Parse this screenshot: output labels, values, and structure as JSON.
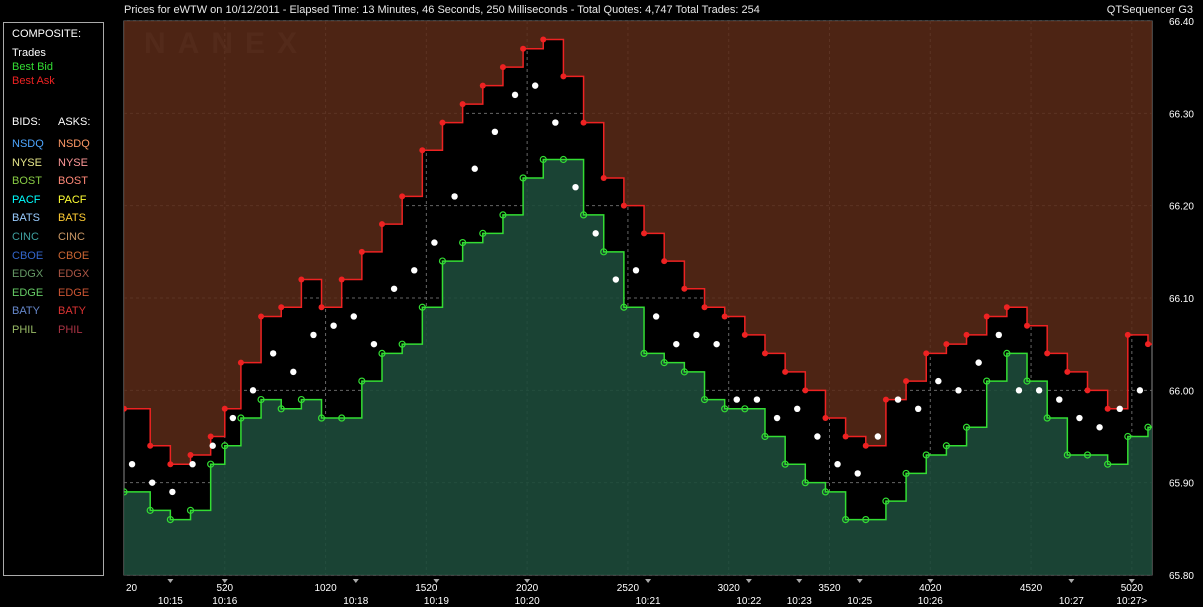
{
  "window": {
    "title": "Prices for  eWTW  on  10/12/2011  -  Elapsed Time: 13 Minutes, 46 Seconds, 250 Milliseconds  -  Total Quotes: 4,747  Total Trades: 254",
    "app_name": "QTSequencer G3"
  },
  "legend": {
    "composite_label": "COMPOSITE:",
    "composite": [
      {
        "label": "Trades",
        "color": "#ffffff"
      },
      {
        "label": "Best Bid",
        "color": "#33dd33"
      },
      {
        "label": "Best Ask",
        "color": "#ee2222"
      }
    ],
    "bids_label": "BIDS:",
    "asks_label": "ASKS:",
    "exchanges": [
      {
        "bid": "NSDQ",
        "ask": "NSDQ",
        "bid_color": "#4da6ff",
        "ask_color": "#ff9966"
      },
      {
        "bid": "NYSE",
        "ask": "NYSE",
        "bid_color": "#e6e68a",
        "ask_color": "#ff9999"
      },
      {
        "bid": "BOST",
        "ask": "BOST",
        "bid_color": "#88cc44",
        "ask_color": "#ff8877"
      },
      {
        "bid": "PACF",
        "ask": "PACF",
        "bid_color": "#00ffff",
        "ask_color": "#ffff33"
      },
      {
        "bid": "BATS",
        "ask": "BATS",
        "bid_color": "#99ccff",
        "ask_color": "#ffcc33"
      },
      {
        "bid": "CINC",
        "ask": "CINC",
        "bid_color": "#3fa0a0",
        "ask_color": "#cc9966"
      },
      {
        "bid": "CBOE",
        "ask": "CBOE",
        "bid_color": "#3366cc",
        "ask_color": "#cc6633"
      },
      {
        "bid": "EDGX",
        "ask": "EDGX",
        "bid_color": "#669966",
        "ask_color": "#aa5544"
      },
      {
        "bid": "EDGE",
        "ask": "EDGE",
        "bid_color": "#66cc66",
        "ask_color": "#cc5533"
      },
      {
        "bid": "BATY",
        "ask": "BATY",
        "bid_color": "#6688cc",
        "ask_color": "#dd3333"
      },
      {
        "bid": "PHIL",
        "ask": "PHIL",
        "bid_color": "#99bb66",
        "ask_color": "#aa3344"
      }
    ]
  },
  "watermark": "NANEX",
  "chart_data": {
    "type": "line",
    "ylim": [
      65.8,
      66.4
    ],
    "y_ticks": [
      "65.80",
      "65.90",
      "66.00",
      "66.10",
      "66.20",
      "66.30",
      "66.40"
    ],
    "x_seq_ticks": [
      "20",
      "520",
      "1020",
      "1520",
      "2020",
      "2520",
      "3020",
      "3520",
      "4020",
      "4520",
      "5020"
    ],
    "x_time_ticks": [
      "10:15",
      "10:16",
      "10:18",
      "10:19",
      "10:20",
      "10:21",
      "10:22",
      "10:23",
      "10:25",
      "10:26",
      "10:27",
      "10:27>"
    ],
    "x_time_seq": [
      250,
      520,
      1170,
      1570,
      2020,
      2620,
      3120,
      3370,
      3670,
      4020,
      4720,
      5020
    ],
    "xlim": [
      20,
      5120
    ],
    "series": [
      {
        "name": "Best Bid",
        "color": "#33dd33",
        "x": [
          20,
          150,
          250,
          350,
          450,
          520,
          600,
          700,
          800,
          900,
          1000,
          1100,
          1200,
          1300,
          1400,
          1500,
          1600,
          1700,
          1800,
          1900,
          2000,
          2100,
          2200,
          2300,
          2400,
          2500,
          2600,
          2700,
          2800,
          2900,
          3000,
          3100,
          3200,
          3300,
          3400,
          3500,
          3600,
          3700,
          3800,
          3900,
          4000,
          4100,
          4200,
          4300,
          4400,
          4500,
          4600,
          4700,
          4800,
          4900,
          5000,
          5100
        ],
        "y": [
          65.89,
          65.87,
          65.86,
          65.87,
          65.92,
          65.94,
          65.97,
          65.99,
          65.98,
          65.99,
          65.97,
          65.97,
          66.01,
          66.04,
          66.05,
          66.09,
          66.14,
          66.16,
          66.17,
          66.19,
          66.23,
          66.25,
          66.25,
          66.19,
          66.15,
          66.09,
          66.04,
          66.03,
          66.02,
          65.99,
          65.98,
          65.98,
          65.95,
          65.92,
          65.9,
          65.89,
          65.86,
          65.86,
          65.88,
          65.91,
          65.93,
          65.94,
          65.96,
          66.01,
          66.04,
          66.01,
          65.97,
          65.93,
          65.93,
          65.92,
          65.95,
          65.96
        ]
      },
      {
        "name": "Best Ask",
        "color": "#ee2222",
        "x": [
          20,
          150,
          250,
          350,
          450,
          520,
          600,
          700,
          800,
          900,
          1000,
          1100,
          1200,
          1300,
          1400,
          1500,
          1600,
          1700,
          1800,
          1900,
          2000,
          2100,
          2200,
          2300,
          2400,
          2500,
          2600,
          2700,
          2800,
          2900,
          3000,
          3100,
          3200,
          3300,
          3400,
          3500,
          3600,
          3700,
          3800,
          3900,
          4000,
          4100,
          4200,
          4300,
          4400,
          4500,
          4600,
          4700,
          4800,
          4900,
          5000,
          5100
        ],
        "y": [
          65.98,
          65.94,
          65.92,
          65.93,
          65.95,
          65.98,
          66.03,
          66.08,
          66.09,
          66.12,
          66.09,
          66.12,
          66.15,
          66.18,
          66.21,
          66.26,
          66.29,
          66.31,
          66.33,
          66.35,
          66.37,
          66.38,
          66.34,
          66.29,
          66.23,
          66.2,
          66.17,
          66.14,
          66.11,
          66.09,
          66.08,
          66.06,
          66.04,
          66.02,
          66.0,
          65.97,
          65.95,
          65.94,
          65.99,
          66.01,
          66.04,
          66.05,
          66.06,
          66.08,
          66.09,
          66.07,
          66.04,
          66.02,
          66.0,
          65.98,
          66.06,
          66.05
        ]
      },
      {
        "name": "Trades",
        "color": "#ffffff",
        "x": [
          60,
          160,
          260,
          360,
          460,
          560,
          660,
          760,
          860,
          960,
          1060,
          1160,
          1260,
          1360,
          1460,
          1560,
          1660,
          1760,
          1860,
          1960,
          2060,
          2160,
          2260,
          2360,
          2460,
          2560,
          2660,
          2760,
          2860,
          2960,
          3060,
          3160,
          3260,
          3360,
          3460,
          3560,
          3660,
          3760,
          3860,
          3960,
          4060,
          4160,
          4260,
          4360,
          4460,
          4560,
          4660,
          4760,
          4860,
          4960,
          5060
        ],
        "y": [
          65.92,
          65.9,
          65.89,
          65.92,
          65.94,
          65.97,
          66.0,
          66.04,
          66.02,
          66.06,
          66.07,
          66.08,
          66.05,
          66.11,
          66.13,
          66.16,
          66.21,
          66.24,
          66.28,
          66.32,
          66.33,
          66.29,
          66.22,
          66.17,
          66.12,
          66.13,
          66.08,
          66.05,
          66.06,
          66.05,
          65.99,
          65.99,
          65.97,
          65.98,
          65.95,
          65.92,
          65.91,
          65.95,
          65.99,
          65.98,
          66.01,
          66.0,
          66.03,
          66.06,
          66.0,
          66.0,
          65.99,
          65.97,
          65.96,
          65.98,
          66.0
        ]
      }
    ]
  }
}
